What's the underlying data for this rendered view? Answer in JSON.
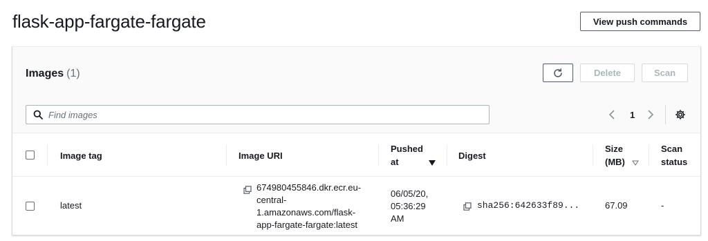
{
  "header": {
    "title": "flask-app-fargate-fargate",
    "push_button": "View push commands"
  },
  "panel": {
    "title": "Images",
    "count": "(1)",
    "actions": {
      "refresh_icon": "refresh-icon",
      "delete_label": "Delete",
      "scan_label": "Scan"
    },
    "search": {
      "placeholder": "Find images",
      "icon": "search-icon"
    },
    "pagination": {
      "current_page": "1",
      "prev_icon": "chevron-left-icon",
      "next_icon": "chevron-right-icon",
      "settings_icon": "gear-icon"
    }
  },
  "table": {
    "columns": {
      "image_tag": "Image tag",
      "image_uri": "Image URI",
      "pushed_at_1": "Pushed",
      "pushed_at_2": "at",
      "digest": "Digest",
      "size_1": "Size",
      "size_2": "(MB)",
      "scan_1": "Scan",
      "scan_2": "status"
    },
    "rows": [
      {
        "tag": "latest",
        "uri_lines": [
          "674980455846.dkr.ecr.eu-",
          "central-",
          "1.amazonaws.com/flask-",
          "app-fargate-fargate:latest"
        ],
        "pushed_lines": [
          "06/05/20,",
          "05:36:29",
          "AM"
        ],
        "digest": "sha256:642633f89...",
        "size": "67.09",
        "scan_status": "-"
      }
    ]
  },
  "colors": {
    "text": "#16191f",
    "muted": "#687078",
    "border": "#aab7b8",
    "disabled": "#aab7b8",
    "header_bg": "#fafafa"
  }
}
